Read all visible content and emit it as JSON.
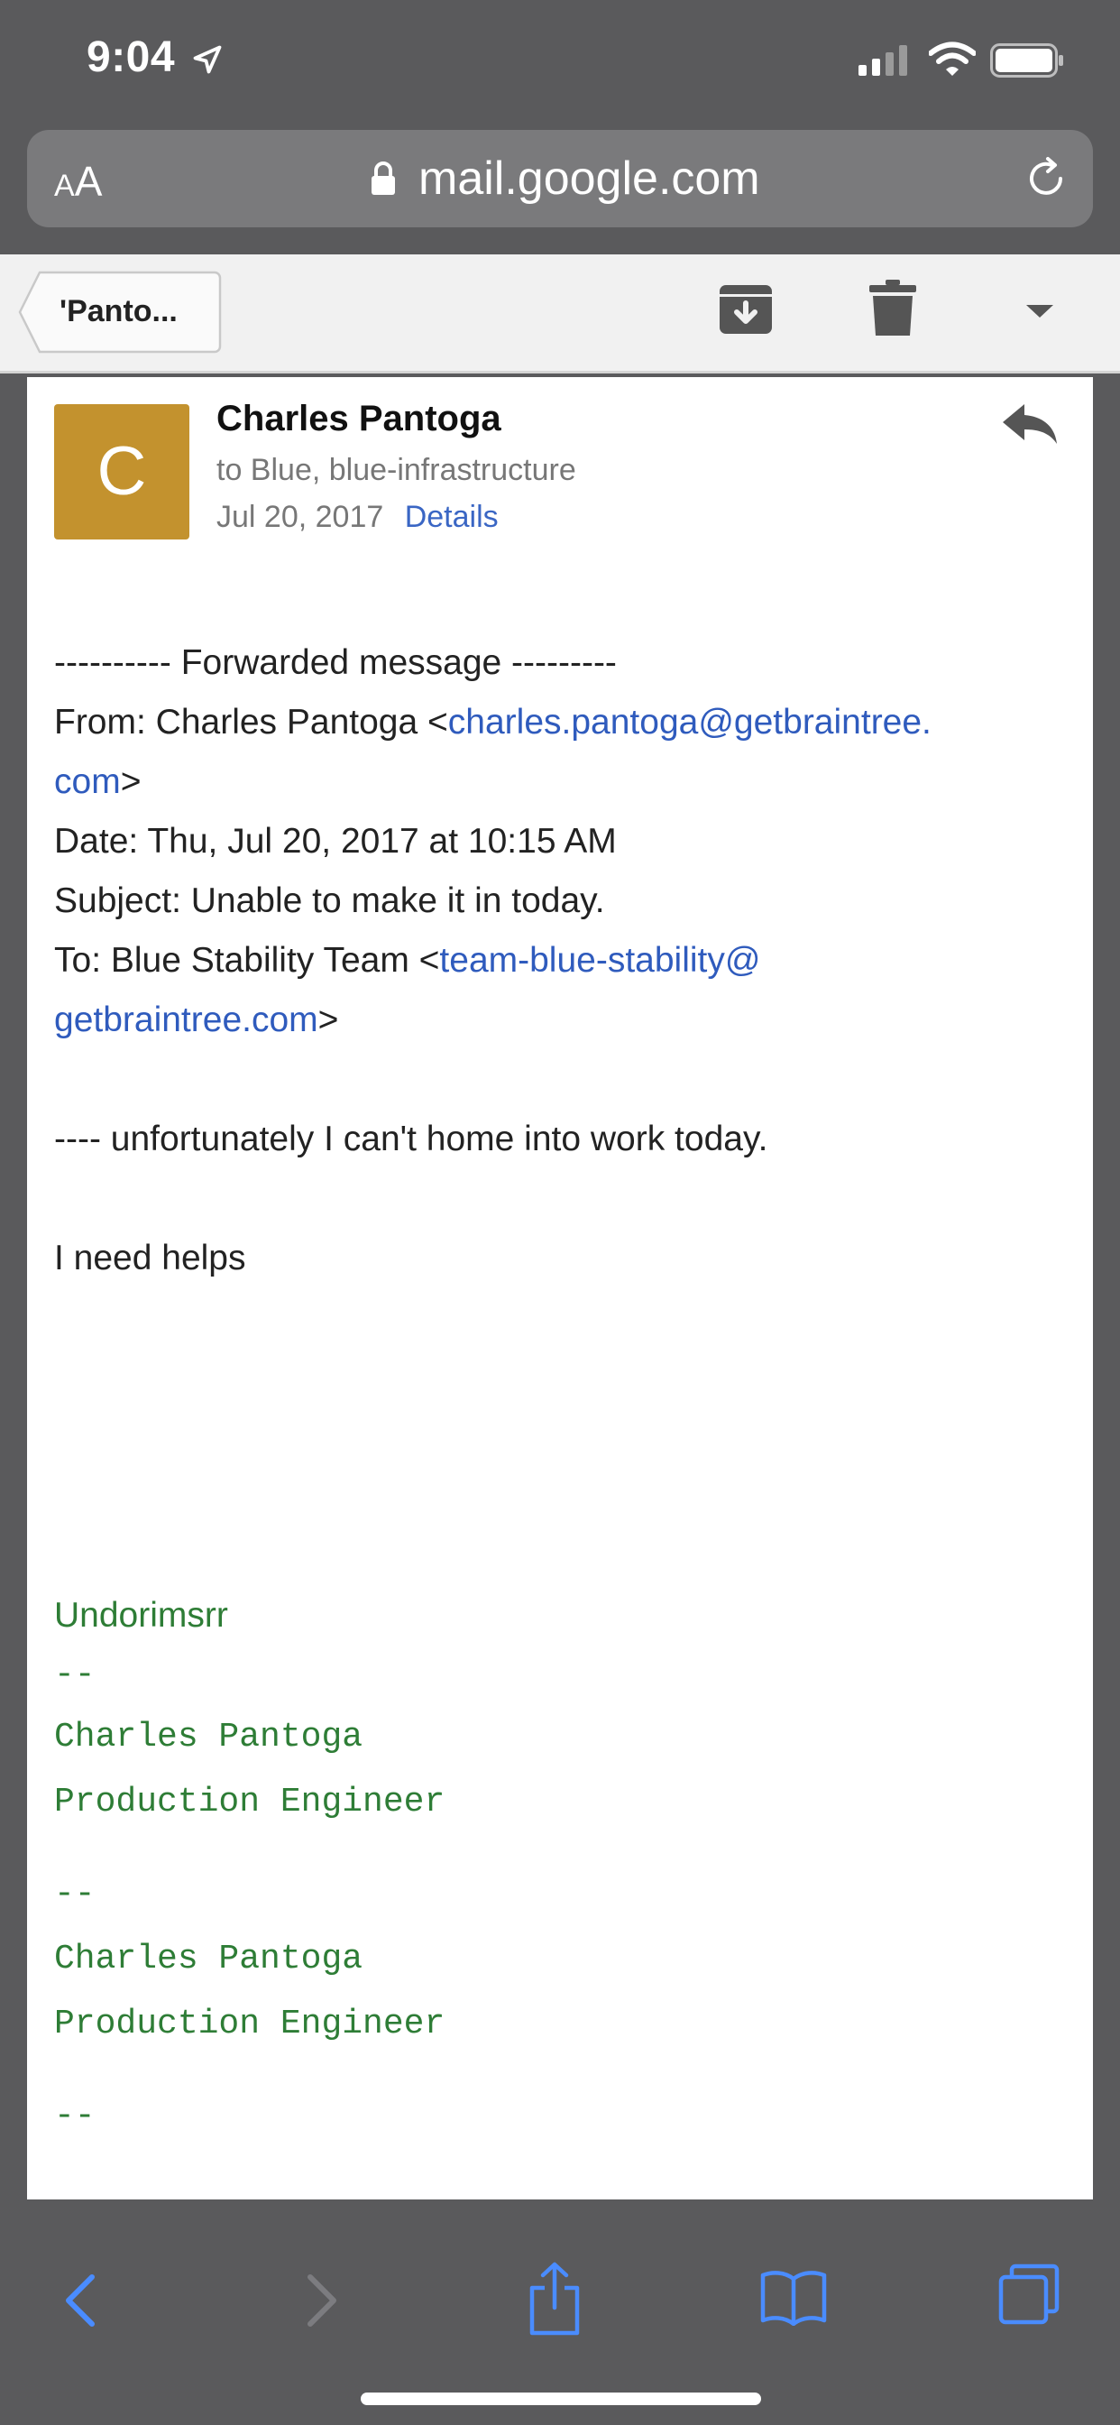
{
  "status_bar": {
    "time": "9:04"
  },
  "url_bar": {
    "aa_small": "A",
    "aa_large": "A",
    "url": "mail.google.com"
  },
  "toolbar": {
    "back_label": "'Panto..."
  },
  "message": {
    "avatar_letter": "C",
    "sender": "Charles Pantoga",
    "recipients": "to Blue, blue-infrastructure",
    "date": "Jul 20, 2017",
    "details_label": "Details",
    "forward_header": "---------- Forwarded message ---------",
    "from_prefix": "From: Charles Pantoga <",
    "from_email_part1": "charles.pantoga@getbraintree.",
    "from_email_part2": "com",
    "from_suffix": ">",
    "date_line": "Date: Thu, Jul 20, 2017 at 10:15 AM",
    "subject_line": "Subject: Unable to make it in today.",
    "to_prefix": "To: Blue Stability Team <",
    "to_email_part1": "team-blue-stability@",
    "to_email_part2": "getbraintree.com",
    "to_suffix": ">",
    "body_line1": "---- unfortunately I can't home into work today.",
    "body_line2": "I need helps",
    "signature_word": "Undorimsrr",
    "sig_sep1": "--",
    "sig_name1": "Charles Pantoga",
    "sig_title1": "Production Engineer",
    "sig_sep2": "--",
    "sig_name2": "Charles Pantoga",
    "sig_title2": "Production Engineer",
    "sig_sep3": "--"
  },
  "colors": {
    "avatar": "#c3922e",
    "link": "#2f5bbd",
    "signature": "#2e7d36",
    "safari_icons": "#4a8cff"
  }
}
